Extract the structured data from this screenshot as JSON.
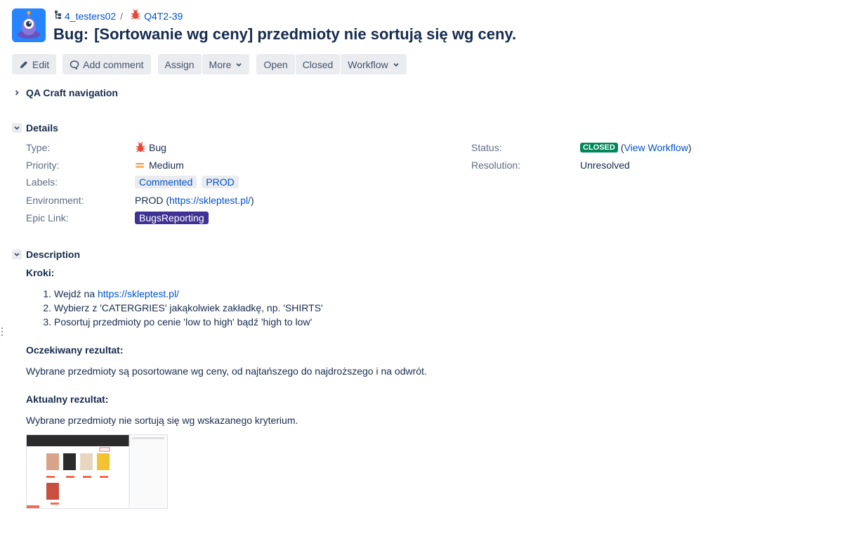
{
  "breadcrumb": {
    "project": "4_testers02",
    "separator": "/",
    "issue_key": "Q4T2-39"
  },
  "issue": {
    "type_prefix": "Bug:",
    "summary": "[Sortowanie wg ceny] przedmioty nie sortują się wg ceny."
  },
  "toolbar": {
    "edit": "Edit",
    "add_comment": "Add comment",
    "assign": "Assign",
    "more": "More",
    "open": "Open",
    "closed": "Closed",
    "workflow": "Workflow"
  },
  "sections": {
    "qa_nav": "QA Craft navigation",
    "details": "Details",
    "description": "Description"
  },
  "details": {
    "type_label": "Type:",
    "type_value": "Bug",
    "priority_label": "Priority:",
    "priority_value": "Medium",
    "labels_label": "Labels:",
    "labels": [
      "Commented",
      "PROD"
    ],
    "environment_label": "Environment:",
    "environment_prefix": "PROD (",
    "environment_link": "https://skleptest.pl/",
    "environment_suffix": ")",
    "epic_label": "Epic Link:",
    "epic_value": "BugsReporting",
    "status_label": "Status:",
    "status_value": "CLOSED",
    "view_workflow_open": "(",
    "view_workflow": "View Workflow",
    "view_workflow_close": ")",
    "resolution_label": "Resolution:",
    "resolution_value": "Unresolved"
  },
  "description": {
    "steps_heading": "Kroki:",
    "step1_prefix": "Wejdź na ",
    "step1_link": "https://skleptest.pl/",
    "step2": "Wybierz z 'CATERGRIES' jakąkolwiek zakładkę, np. 'SHIRTS'",
    "step3": "Posortuj przedmioty po cenie 'low to high' bądź 'high to low'",
    "expected_heading": "Oczekiwany rezultat:",
    "expected_text": "Wybrane przedmioty są posortowane wg ceny, od najtańszego do najdroższego i na odwrót.",
    "actual_heading": "Aktualny rezultat:",
    "actual_text": "Wybrane przedmioty nie sortują się wg wskazanego kryterium."
  },
  "colors": {
    "accent": "#0052cc",
    "closed_lozenge": "#00875a",
    "epic": "#403294",
    "bug_red": "#e5493a",
    "priority_medium": "#f79232"
  }
}
